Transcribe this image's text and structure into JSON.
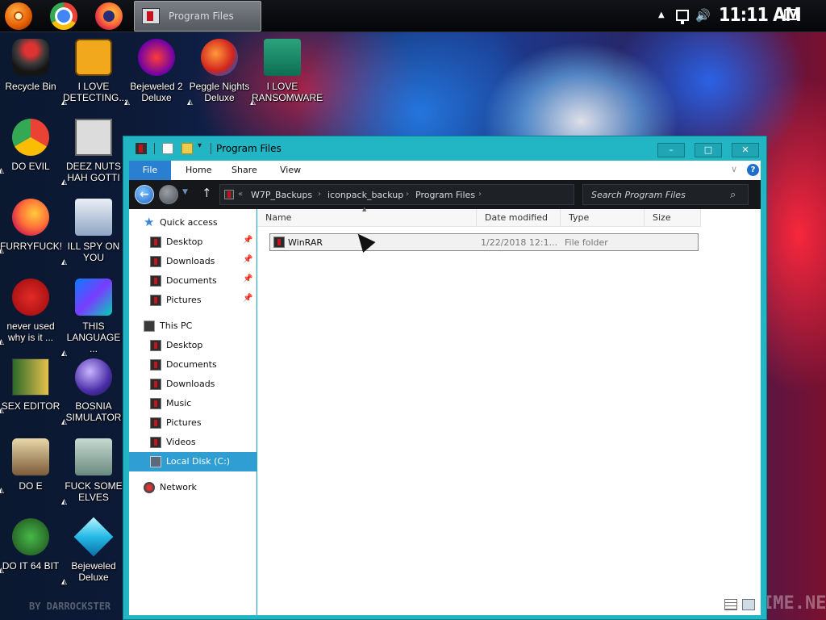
{
  "taskbar": {
    "pinned": [
      {
        "name": "start-orb-icon"
      },
      {
        "name": "chrome-icon"
      },
      {
        "name": "firefox-icon"
      }
    ],
    "active_task_label": "Program Files",
    "clock": "11:11 AM"
  },
  "desktop": {
    "icons": [
      {
        "label": "Recycle Bin",
        "icon": "recycle-bin-icon"
      },
      {
        "label": "I LOVE\nDETECTING...",
        "icon": "detect-it-easy-icon"
      },
      {
        "label": "Bejeweled 2\nDeluxe",
        "icon": "bejeweled-2-icon"
      },
      {
        "label": "Peggle Nights\nDeluxe",
        "icon": "peggle-nights-icon"
      },
      {
        "label": "I LOVE\nRANSOMWARE",
        "icon": "publisher-icon"
      },
      {
        "label": "DO EVIL",
        "icon": "chrome-icon"
      },
      {
        "label": "DEEZ NUTS\nHAH GOTTI",
        "icon": "windows-copy-icon"
      },
      {
        "label": "FURRYFUCK!",
        "icon": "firefox-icon"
      },
      {
        "label": "ILL SPY ON\nYOU",
        "icon": "network-spy-icon"
      },
      {
        "label": "never used\nwhy is it ...",
        "icon": "dev-cpp-icon"
      },
      {
        "label": "THIS\nLANGUAGE ...",
        "icon": "goland-icon"
      },
      {
        "label": "SEX EDITOR",
        "icon": "hxd-hex-editor-icon"
      },
      {
        "label": "BOSNIA\nSIMULATOR",
        "icon": "mine-icon"
      },
      {
        "label": "DO  E",
        "icon": "portrait-icon"
      },
      {
        "label": "FUCK SOME\nELVES",
        "icon": "wizard-icon"
      },
      {
        "label": "DO IT 64 BIT",
        "icon": "frog-64-icon"
      },
      {
        "label": "Bejeweled\nDeluxe",
        "icon": "diamond-icon"
      }
    ],
    "watermark": "IME.NET",
    "credit": "BY DARROCKSTER"
  },
  "window": {
    "title": "Program Files",
    "caption_buttons": {
      "minimize": "–",
      "maximize": "□",
      "close": "✕"
    },
    "ribbon_tabs": [
      "File",
      "Home",
      "Share",
      "View"
    ],
    "help": "?",
    "breadcrumb": [
      "W7P_Backups",
      "iconpack_backup",
      "Program Files"
    ],
    "search_placeholder": "Search Program Files",
    "nav": {
      "quick_access": "Quick access",
      "quick_items": [
        "Desktop",
        "Downloads",
        "Documents",
        "Pictures"
      ],
      "this_pc": "This PC",
      "pc_items": [
        "Desktop",
        "Documents",
        "Downloads",
        "Music",
        "Pictures",
        "Videos",
        "Local Disk (C:)"
      ],
      "network": "Network",
      "selected": "Local Disk (C:)"
    },
    "columns": [
      "Name",
      "Date modified",
      "Type",
      "Size"
    ],
    "rows": [
      {
        "name": "WinRAR",
        "date": "1/22/2018 12:1...",
        "type": "File folder",
        "size": ""
      }
    ]
  },
  "colors": {
    "window_frame": "#22b5c4",
    "file_tab": "#2b7fd0",
    "nav_selected": "#2e9ed3",
    "address_bar": "#15171b"
  }
}
